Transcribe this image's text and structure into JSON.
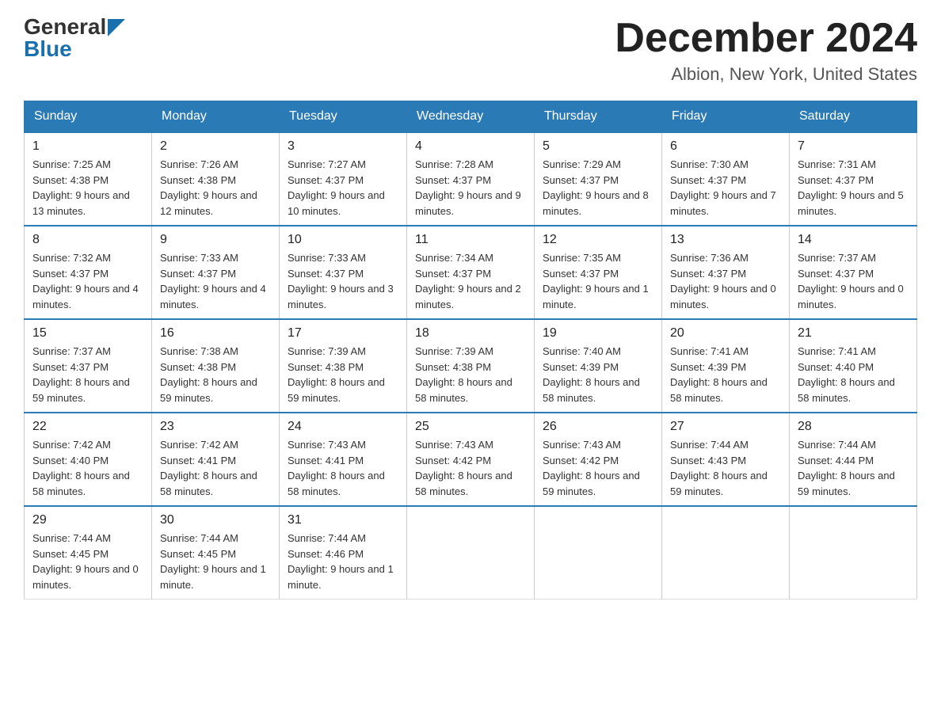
{
  "header": {
    "logo_general": "General",
    "logo_blue": "Blue",
    "month_title": "December 2024",
    "location": "Albion, New York, United States"
  },
  "days_of_week": [
    "Sunday",
    "Monday",
    "Tuesday",
    "Wednesday",
    "Thursday",
    "Friday",
    "Saturday"
  ],
  "weeks": [
    [
      {
        "day": "1",
        "sunrise": "7:25 AM",
        "sunset": "4:38 PM",
        "daylight": "9 hours and 13 minutes."
      },
      {
        "day": "2",
        "sunrise": "7:26 AM",
        "sunset": "4:38 PM",
        "daylight": "9 hours and 12 minutes."
      },
      {
        "day": "3",
        "sunrise": "7:27 AM",
        "sunset": "4:37 PM",
        "daylight": "9 hours and 10 minutes."
      },
      {
        "day": "4",
        "sunrise": "7:28 AM",
        "sunset": "4:37 PM",
        "daylight": "9 hours and 9 minutes."
      },
      {
        "day": "5",
        "sunrise": "7:29 AM",
        "sunset": "4:37 PM",
        "daylight": "9 hours and 8 minutes."
      },
      {
        "day": "6",
        "sunrise": "7:30 AM",
        "sunset": "4:37 PM",
        "daylight": "9 hours and 7 minutes."
      },
      {
        "day": "7",
        "sunrise": "7:31 AM",
        "sunset": "4:37 PM",
        "daylight": "9 hours and 5 minutes."
      }
    ],
    [
      {
        "day": "8",
        "sunrise": "7:32 AM",
        "sunset": "4:37 PM",
        "daylight": "9 hours and 4 minutes."
      },
      {
        "day": "9",
        "sunrise": "7:33 AM",
        "sunset": "4:37 PM",
        "daylight": "9 hours and 4 minutes."
      },
      {
        "day": "10",
        "sunrise": "7:33 AM",
        "sunset": "4:37 PM",
        "daylight": "9 hours and 3 minutes."
      },
      {
        "day": "11",
        "sunrise": "7:34 AM",
        "sunset": "4:37 PM",
        "daylight": "9 hours and 2 minutes."
      },
      {
        "day": "12",
        "sunrise": "7:35 AM",
        "sunset": "4:37 PM",
        "daylight": "9 hours and 1 minute."
      },
      {
        "day": "13",
        "sunrise": "7:36 AM",
        "sunset": "4:37 PM",
        "daylight": "9 hours and 0 minutes."
      },
      {
        "day": "14",
        "sunrise": "7:37 AM",
        "sunset": "4:37 PM",
        "daylight": "9 hours and 0 minutes."
      }
    ],
    [
      {
        "day": "15",
        "sunrise": "7:37 AM",
        "sunset": "4:37 PM",
        "daylight": "8 hours and 59 minutes."
      },
      {
        "day": "16",
        "sunrise": "7:38 AM",
        "sunset": "4:38 PM",
        "daylight": "8 hours and 59 minutes."
      },
      {
        "day": "17",
        "sunrise": "7:39 AM",
        "sunset": "4:38 PM",
        "daylight": "8 hours and 59 minutes."
      },
      {
        "day": "18",
        "sunrise": "7:39 AM",
        "sunset": "4:38 PM",
        "daylight": "8 hours and 58 minutes."
      },
      {
        "day": "19",
        "sunrise": "7:40 AM",
        "sunset": "4:39 PM",
        "daylight": "8 hours and 58 minutes."
      },
      {
        "day": "20",
        "sunrise": "7:41 AM",
        "sunset": "4:39 PM",
        "daylight": "8 hours and 58 minutes."
      },
      {
        "day": "21",
        "sunrise": "7:41 AM",
        "sunset": "4:40 PM",
        "daylight": "8 hours and 58 minutes."
      }
    ],
    [
      {
        "day": "22",
        "sunrise": "7:42 AM",
        "sunset": "4:40 PM",
        "daylight": "8 hours and 58 minutes."
      },
      {
        "day": "23",
        "sunrise": "7:42 AM",
        "sunset": "4:41 PM",
        "daylight": "8 hours and 58 minutes."
      },
      {
        "day": "24",
        "sunrise": "7:43 AM",
        "sunset": "4:41 PM",
        "daylight": "8 hours and 58 minutes."
      },
      {
        "day": "25",
        "sunrise": "7:43 AM",
        "sunset": "4:42 PM",
        "daylight": "8 hours and 58 minutes."
      },
      {
        "day": "26",
        "sunrise": "7:43 AM",
        "sunset": "4:42 PM",
        "daylight": "8 hours and 59 minutes."
      },
      {
        "day": "27",
        "sunrise": "7:44 AM",
        "sunset": "4:43 PM",
        "daylight": "8 hours and 59 minutes."
      },
      {
        "day": "28",
        "sunrise": "7:44 AM",
        "sunset": "4:44 PM",
        "daylight": "8 hours and 59 minutes."
      }
    ],
    [
      {
        "day": "29",
        "sunrise": "7:44 AM",
        "sunset": "4:45 PM",
        "daylight": "9 hours and 0 minutes."
      },
      {
        "day": "30",
        "sunrise": "7:44 AM",
        "sunset": "4:45 PM",
        "daylight": "9 hours and 1 minute."
      },
      {
        "day": "31",
        "sunrise": "7:44 AM",
        "sunset": "4:46 PM",
        "daylight": "9 hours and 1 minute."
      },
      null,
      null,
      null,
      null
    ]
  ]
}
